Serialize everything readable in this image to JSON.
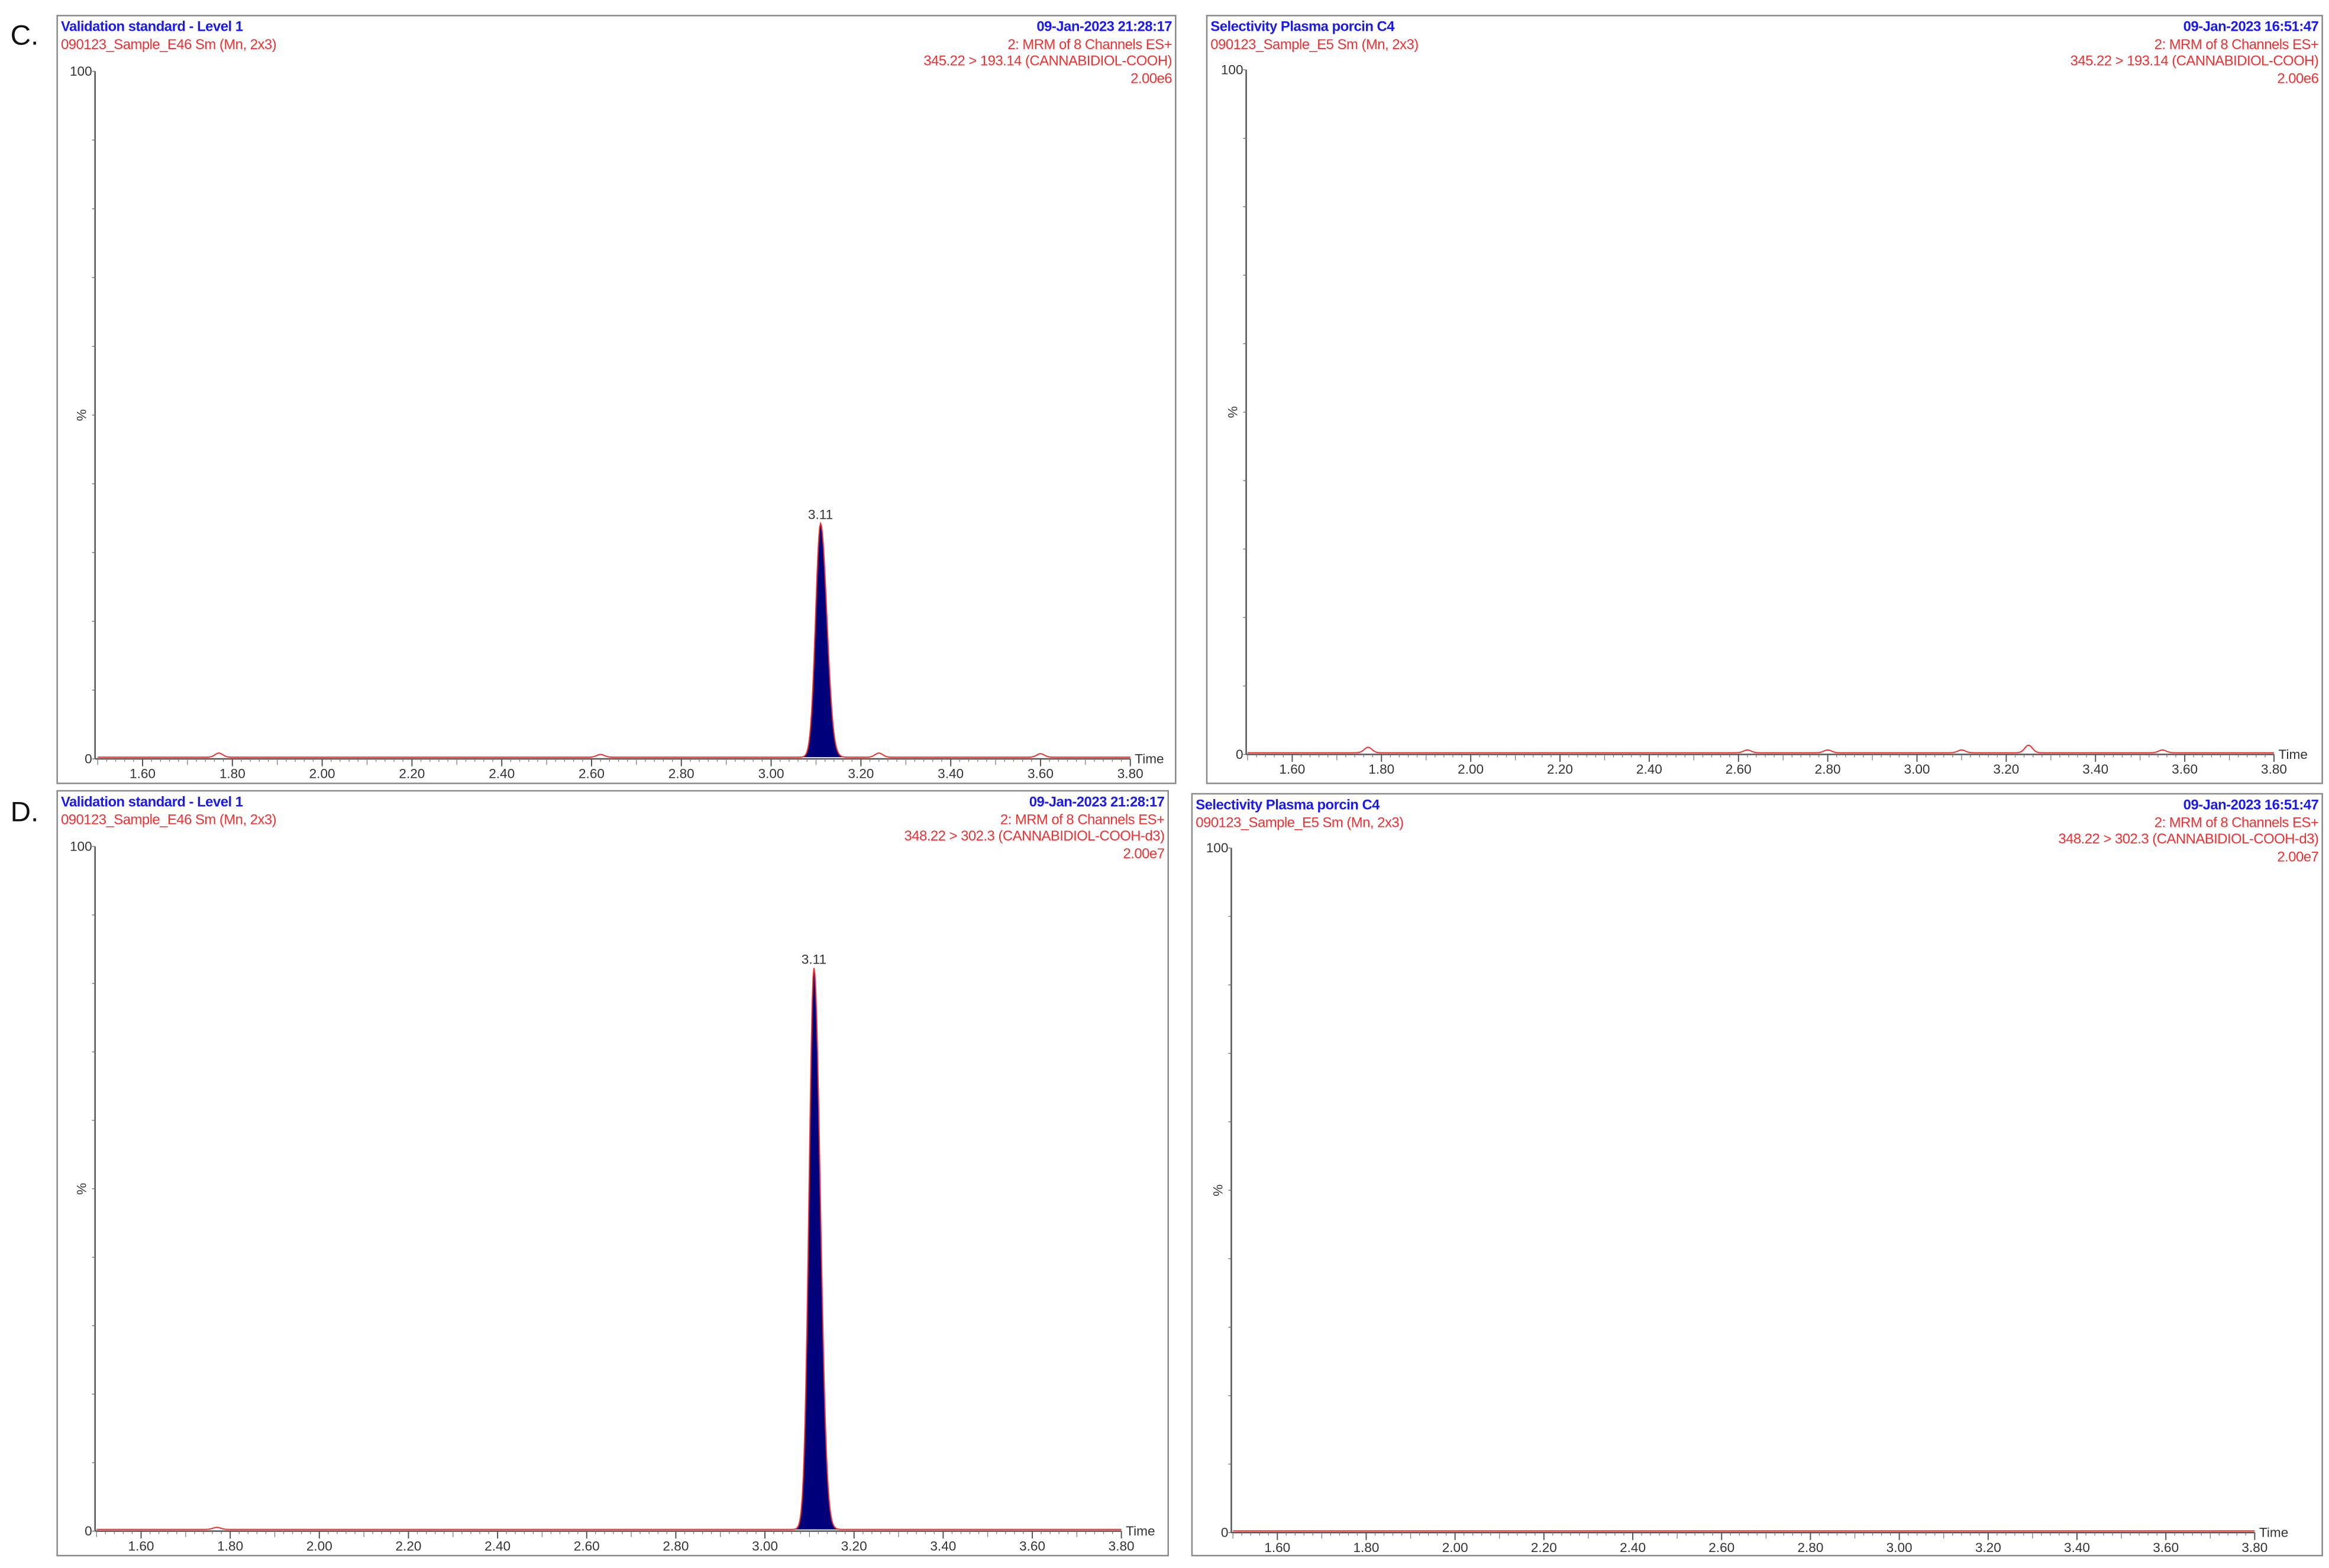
{
  "labels": {
    "c": "C.",
    "d": "D."
  },
  "chart_data": [
    {
      "type": "area",
      "id": "C-left",
      "title": "Validation standard - Level 1",
      "sample": "090123_Sample_E46 Sm (Mn, 2x3)",
      "datetime": "09-Jan-2023  21:28:17",
      "channel": "2: MRM of 8 Channels ES+",
      "transition": "345.22 > 193.14 (CANNABIDIOL-COOH)",
      "intensity": "2.00e6",
      "ylabel": "%",
      "y_top": "100",
      "y_zero": "0",
      "ylim": [
        0,
        100
      ],
      "xlabel": "Time",
      "xlim": [
        1.5,
        3.8
      ],
      "x_ticks": [
        "1.60",
        "1.80",
        "2.00",
        "2.20",
        "2.40",
        "2.60",
        "2.80",
        "3.00",
        "3.20",
        "3.40",
        "3.60",
        "3.80"
      ],
      "peaks": [
        {
          "rt": 3.11,
          "label": "3.11",
          "height_pct": 34,
          "filled": true
        }
      ],
      "noise_bumps": [
        {
          "rt": 1.77,
          "height_pct": 0.6
        },
        {
          "rt": 2.62,
          "height_pct": 0.4
        },
        {
          "rt": 3.24,
          "height_pct": 0.6
        },
        {
          "rt": 3.6,
          "height_pct": 0.5
        }
      ]
    },
    {
      "type": "area",
      "id": "C-right",
      "title": "Selectivity Plasma porcin C4",
      "sample": "090123_Sample_E5 Sm (Mn, 2x3)",
      "datetime": "09-Jan-2023  16:51:47",
      "channel": "2: MRM of 8 Channels ES+",
      "transition": "345.22 > 193.14 (CANNABIDIOL-COOH)",
      "intensity": "2.00e6",
      "ylabel": "%",
      "y_top": "100",
      "y_zero": "0",
      "ylim": [
        0,
        100
      ],
      "xlabel": "Time",
      "xlim": [
        1.5,
        3.8
      ],
      "x_ticks": [
        "1.60",
        "1.80",
        "2.00",
        "2.20",
        "2.40",
        "2.60",
        "2.80",
        "3.00",
        "3.20",
        "3.40",
        "3.60",
        "3.80"
      ],
      "peaks": [],
      "noise_bumps": [
        {
          "rt": 1.77,
          "height_pct": 0.8
        },
        {
          "rt": 2.62,
          "height_pct": 0.4
        },
        {
          "rt": 2.8,
          "height_pct": 0.4
        },
        {
          "rt": 3.1,
          "height_pct": 0.4
        },
        {
          "rt": 3.25,
          "height_pct": 1.1
        },
        {
          "rt": 3.55,
          "height_pct": 0.4
        }
      ]
    },
    {
      "type": "area",
      "id": "D-left",
      "title": "Validation standard - Level 1",
      "sample": "090123_Sample_E46 Sm (Mn, 2x3)",
      "datetime": "09-Jan-2023  21:28:17",
      "channel": "2: MRM of 8 Channels ES+",
      "transition": "348.22 > 302.3 (CANNABIDIOL-COOH-d3)",
      "intensity": "2.00e7",
      "ylabel": "%",
      "y_top": "100",
      "y_zero": "0",
      "ylim": [
        0,
        100
      ],
      "xlabel": "Time",
      "xlim": [
        1.5,
        3.8
      ],
      "x_ticks": [
        "1.60",
        "1.80",
        "2.00",
        "2.20",
        "2.40",
        "2.60",
        "2.80",
        "3.00",
        "3.20",
        "3.40",
        "3.60",
        "3.80"
      ],
      "peaks": [
        {
          "rt": 3.11,
          "label": "3.11",
          "height_pct": 82,
          "filled": true
        }
      ],
      "noise_bumps": [
        {
          "rt": 1.77,
          "height_pct": 0.3
        }
      ]
    },
    {
      "type": "area",
      "id": "D-right",
      "title": "Selectivity Plasma porcin C4",
      "sample": "090123_Sample_E5 Sm (Mn, 2x3)",
      "datetime": "09-Jan-2023  16:51:47",
      "channel": "2: MRM of 8 Channels ES+",
      "transition": "348.22 > 302.3 (CANNABIDIOL-COOH-d3)",
      "intensity": "2.00e7",
      "ylabel": "%",
      "y_top": "100",
      "y_zero": "0",
      "ylim": [
        0,
        100
      ],
      "xlabel": "Time",
      "xlim": [
        1.5,
        3.8
      ],
      "x_ticks": [
        "1.60",
        "1.80",
        "2.00",
        "2.20",
        "2.40",
        "2.60",
        "2.80",
        "3.00",
        "3.20",
        "3.40",
        "3.60",
        "3.80"
      ],
      "peaks": [],
      "noise_bumps": []
    }
  ],
  "colors": {
    "title": "#1a1aee",
    "trace": "#f03030",
    "fill": "#00007a",
    "axis": "#555555"
  }
}
